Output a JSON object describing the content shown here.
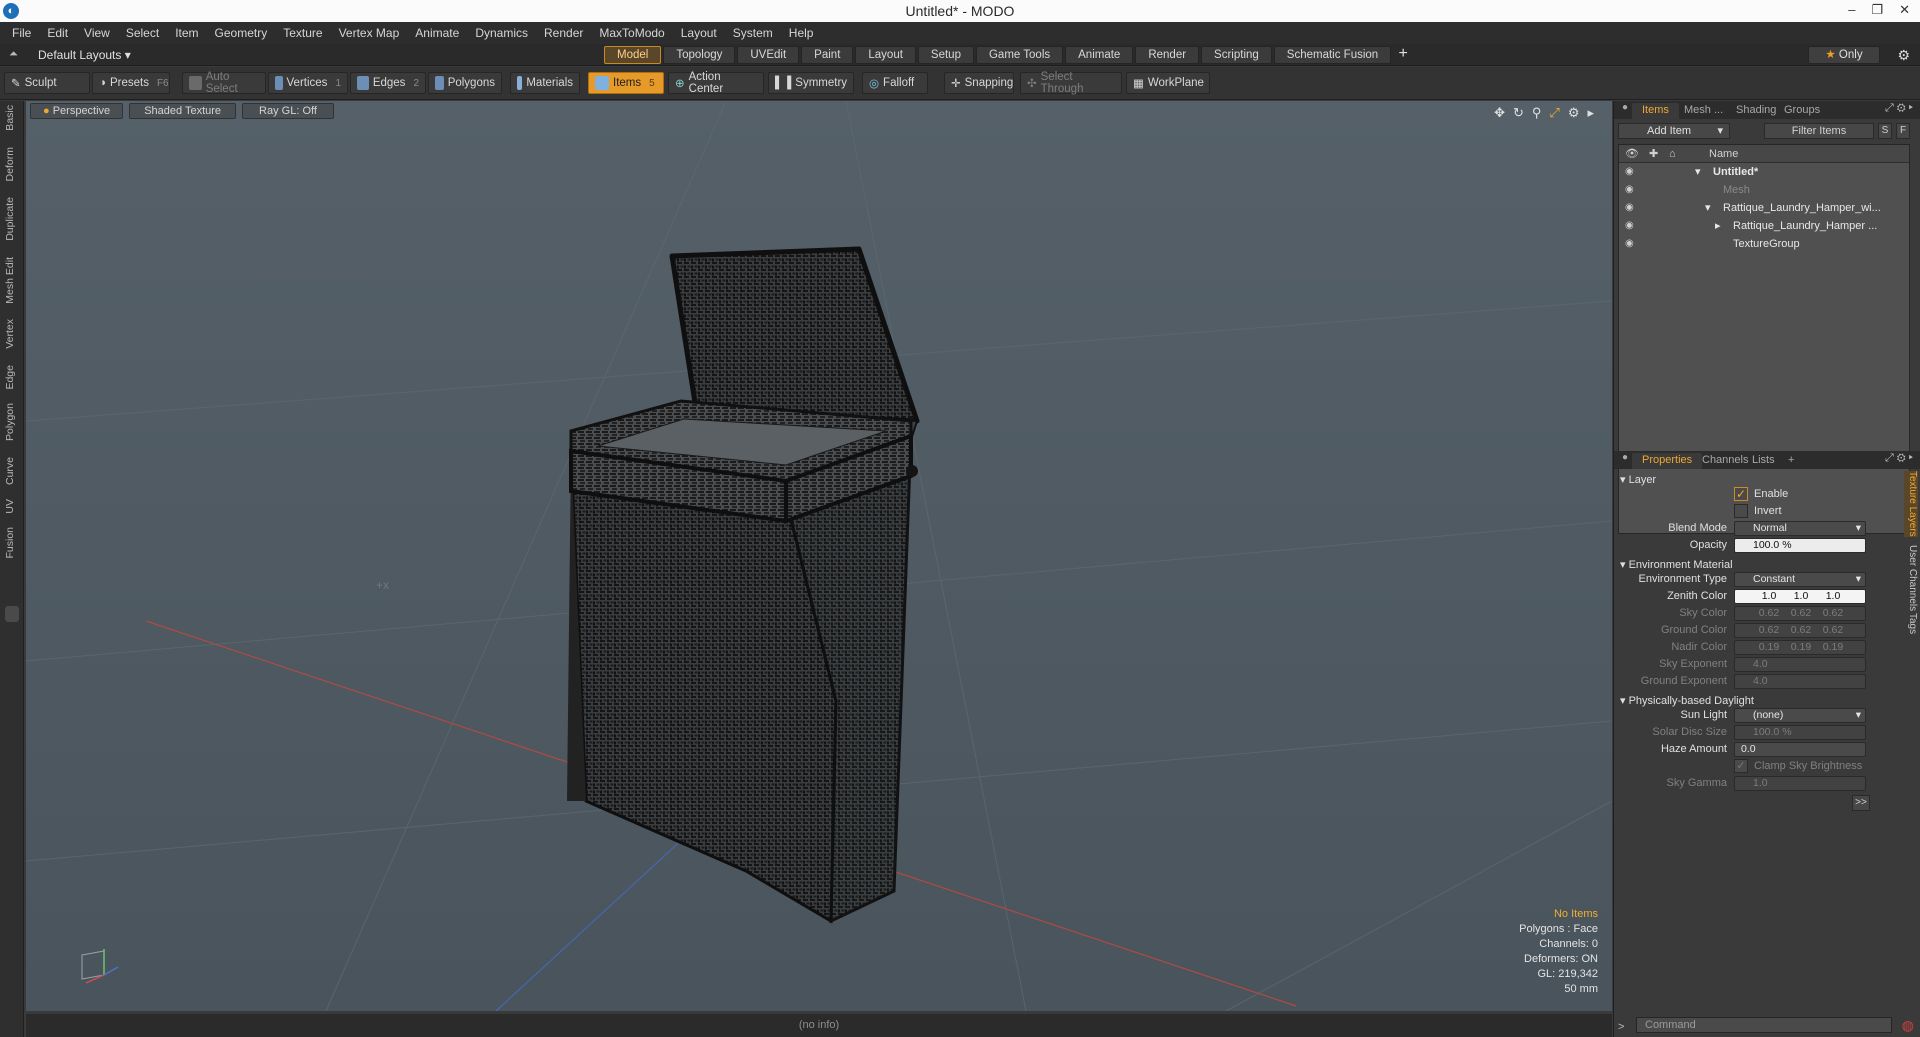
{
  "window": {
    "title": "Untitled* - MODO",
    "controls": [
      "–",
      "❐",
      "✕"
    ]
  },
  "menu": [
    "File",
    "Edit",
    "View",
    "Select",
    "Item",
    "Geometry",
    "Texture",
    "Vertex Map",
    "Animate",
    "Dynamics",
    "Render",
    "MaxToModo",
    "Layout",
    "System",
    "Help"
  ],
  "layoutbar": {
    "layouts_label": "Default Layouts ▾",
    "tabs": [
      "Model",
      "Topology",
      "UVEdit",
      "Paint",
      "Layout",
      "Setup",
      "Game Tools",
      "Animate",
      "Render",
      "Scripting",
      "Schematic Fusion"
    ],
    "active_tab": "Model",
    "only_label": "Only"
  },
  "toolbar": {
    "sculpt": "Sculpt",
    "presets": "Presets",
    "presets_key": "F6",
    "auto_select": "Auto Select",
    "vertices": "Vertices",
    "vertices_key": "1",
    "edges": "Edges",
    "edges_key": "2",
    "polygons": "Polygons",
    "materials": "Materials",
    "items": "Items",
    "items_key": "5",
    "action_center": "Action Center",
    "symmetry": "Symmetry",
    "falloff": "Falloff",
    "snapping": "Snapping",
    "select_through": "Select Through",
    "workplane": "WorkPlane"
  },
  "left_tabs": [
    "Basic",
    "Deform",
    "Duplicate",
    "Mesh Edit",
    "Vertex",
    "Edge",
    "Polygon",
    "Curve",
    "UV",
    "Fusion"
  ],
  "viewport": {
    "perspective": "Perspective",
    "shading": "Shaded Texture",
    "raygl": "Ray GL: Off",
    "info": {
      "items": "No Items",
      "polygons": "Polygons : Face",
      "channels": "Channels: 0",
      "deformers": "Deformers: ON",
      "gl": "GL: 219,342",
      "units": "50 mm"
    }
  },
  "status": "(no info)",
  "items_panel": {
    "tabs": [
      "Items",
      "Mesh ...",
      "Shading",
      "Groups"
    ],
    "add_item": "Add Item",
    "filter": "Filter Items",
    "s_btn": "S",
    "f_btn": "F",
    "name_header": "Name",
    "rows": [
      {
        "label": "Untitled*"
      },
      {
        "label": "Mesh"
      },
      {
        "label": "Rattique_Laundry_Hamper_wi..."
      },
      {
        "label": "Rattique_Laundry_Hamper ..."
      },
      {
        "label": "TextureGroup"
      }
    ]
  },
  "properties": {
    "tabs": [
      "Properties",
      "Channels",
      "Lists",
      "+"
    ],
    "side_tabs": [
      "Texture Layers",
      "User Channels",
      "Tags"
    ],
    "layer_section": "Layer",
    "enable": "Enable",
    "invert": "Invert",
    "blend_mode_label": "Blend Mode",
    "blend_mode": "Normal",
    "opacity_label": "Opacity",
    "opacity": "100.0 %",
    "env_section": "Environment Material",
    "env_type_label": "Environment Type",
    "env_type": "Constant",
    "zenith_label": "Zenith Color",
    "zenith": [
      "1.0",
      "1.0",
      "1.0"
    ],
    "sky_label": "Sky Color",
    "sky": [
      "0.62",
      "0.62",
      "0.62"
    ],
    "ground_label": "Ground Color",
    "ground": [
      "0.62",
      "0.62",
      "0.62"
    ],
    "nadir_label": "Nadir Color",
    "nadir": [
      "0.19",
      "0.19",
      "0.19"
    ],
    "sky_exp_label": "Sky Exponent",
    "sky_exp": "4.0",
    "ground_exp_label": "Ground Exponent",
    "ground_exp": "4.0",
    "daylight_section": "Physically-based Daylight",
    "sun_label": "Sun Light",
    "sun": "(none)",
    "solar_label": "Solar Disc Size",
    "solar": "100.0 %",
    "haze_label": "Haze Amount",
    "haze": "0.0",
    "clamp_label": "Clamp Sky Brightness",
    "gamma_label": "Sky Gamma",
    "gamma": "1.0",
    "more": ">>"
  },
  "command": {
    "placeholder": "Command"
  },
  "colors": {
    "accent": "#e69a2a",
    "viewport_bg": "#515c64",
    "panel_bg": "#3a3a3a"
  }
}
